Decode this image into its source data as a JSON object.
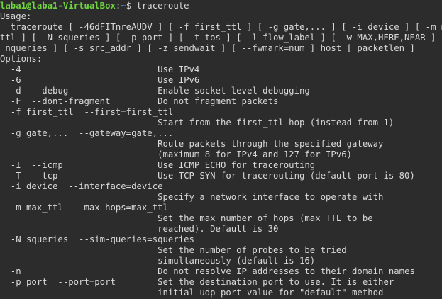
{
  "prompt": {
    "user_host": "laba1@laba1-VirtualBox",
    "separator": ":",
    "path": "~",
    "dollar": "$ ",
    "command": "traceroute"
  },
  "output_lines": [
    "Usage:",
    "  traceroute [ -46dFITnreAUDV ] [ -f first_ttl ] [ -g gate,... ] [ -i device ] [ -m max_",
    "ttl ] [ -N squeries ] [ -p port ] [ -t tos ] [ -l flow_label ] [ -w MAX,HERE,NEAR ] [ -q",
    " nqueries ] [ -s src_addr ] [ -z sendwait ] [ --fwmark=num ] host [ packetlen ]",
    "Options:",
    "  -4                          Use IPv4",
    "  -6                          Use IPv6",
    "  -d  --debug                 Enable socket level debugging",
    "  -F  --dont-fragment         Do not fragment packets",
    "  -f first_ttl  --first=first_ttl",
    "                              Start from the first_ttl hop (instead from 1)",
    "  -g gate,...  --gateway=gate,...",
    "                              Route packets through the specified gateway",
    "                              (maximum 8 for IPv4 and 127 for IPv6)",
    "  -I  --icmp                  Use ICMP ECHO for tracerouting",
    "  -T  --tcp                   Use TCP SYN for tracerouting (default port is 80)",
    "  -i device  --interface=device",
    "                              Specify a network interface to operate with",
    "  -m max_ttl  --max-hops=max_ttl",
    "                              Set the max number of hops (max TTL to be",
    "                              reached). Default is 30",
    "  -N squeries  --sim-queries=squeries",
    "                              Set the number of probes to be tried",
    "                              simultaneously (default is 16)",
    "  -n                          Do not resolve IP addresses to their domain names",
    "  -p port  --port=port        Set the destination port to use. It is either",
    "                              initial udp port value for \"default\" method"
  ]
}
